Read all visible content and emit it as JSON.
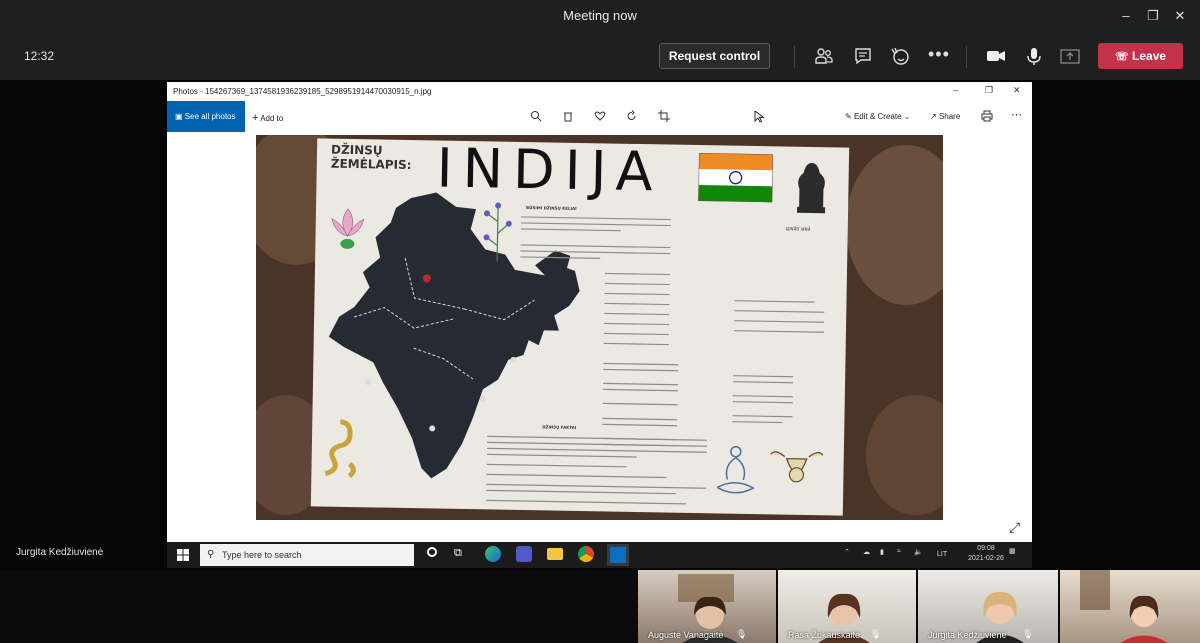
{
  "window": {
    "title": "Meeting now"
  },
  "toolbar": {
    "clock": "12:32",
    "request_control": "Request control",
    "leave": "Leave",
    "icons": [
      "participants-icon",
      "chat-icon",
      "reactions-icon",
      "more-icon",
      "camera-icon",
      "mic-icon",
      "share-icon"
    ]
  },
  "stage": {
    "presenter": "Jurgita Kedžiuvienė"
  },
  "photos": {
    "title": "Photos - 154267369_1374581936239185_5298951914470030915_n.jpg",
    "see_all": "See all photos",
    "add_to": "Add to",
    "edit_create": "Edit & Create",
    "share": "Share"
  },
  "poster": {
    "heading_left": "DŽINSŲ\nŽEMĖLAPIS:",
    "heading_main": "INDIJA",
    "emblem_caption": "सत्यमेव जयते",
    "section1": "BŪSIMI DŽINSŲ KELIAI",
    "section2": "DŽINSŲ FAKTAI"
  },
  "taskbar": {
    "search_placeholder": "Type here to search",
    "lang": "LIT",
    "time": "09:08",
    "date": "2021-02-26"
  },
  "participants": [
    {
      "name": "Augustė Vanagaitė"
    },
    {
      "name": "Rasa Žukauskaitė"
    },
    {
      "name": "Jurgita Kedžiuvienė"
    },
    {
      "name": ""
    }
  ],
  "colors": {
    "leave": "#c4314b",
    "accent": "#0063b1",
    "saffron": "#f08a24",
    "india_green": "#138808"
  }
}
